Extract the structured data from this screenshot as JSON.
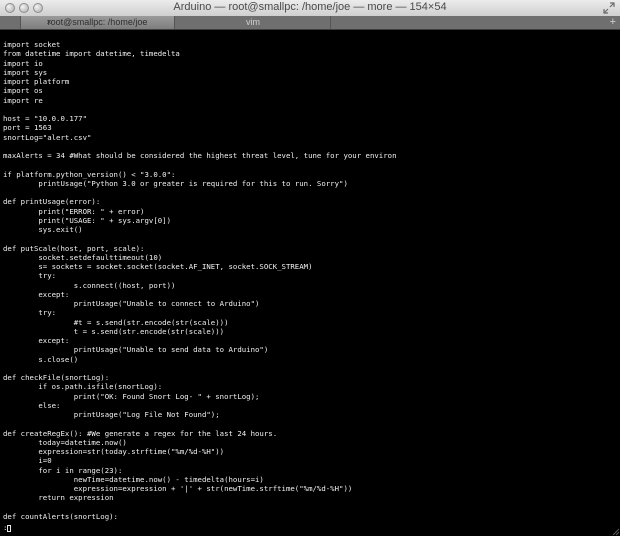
{
  "window": {
    "title": "Arduino — root@smallpc: /home/joe — more — 154×54"
  },
  "tabs": [
    {
      "label": "root@smallpc: /home/joe",
      "active": true
    },
    {
      "label": "vim",
      "active": false
    }
  ],
  "tab_bar": {
    "add_label": "+"
  },
  "terminal": {
    "lines": [
      "import socket",
      "from datetime import datetime, timedelta",
      "import io",
      "import sys",
      "import platform",
      "import os",
      "import re",
      "",
      "host = \"10.0.0.177\"",
      "port = 1563",
      "snortLog=\"alert.csv\"",
      "",
      "maxAlerts = 34 #What should be considered the highest threat level, tune for your environ",
      "",
      "if platform.python_version() < \"3.0.0\":",
      "        printUsage(\"Python 3.0 or greater is required for this to run. Sorry\")",
      "",
      "def printUsage(error):",
      "        print(\"ERROR: \" + error)",
      "        print(\"USAGE: \" + sys.argv[0])",
      "        sys.exit()",
      "",
      "def putScale(host, port, scale):",
      "        socket.setdefaulttimeout(10)",
      "        s= sockets = socket.socket(socket.AF_INET, socket.SOCK_STREAM)",
      "        try:",
      "                s.connect((host, port))",
      "        except:",
      "                printUsage(\"Unable to connect to Arduino\")",
      "        try:",
      "                #t = s.send(str.encode(str(scale)))",
      "                t = s.send(str.encode(str(scale)))",
      "        except:",
      "                printUsage(\"Unable to send data to Arduino\")",
      "        s.close()",
      "",
      "def checkFile(snortLog):",
      "        if os.path.isfile(snortLog):",
      "                print(\"OK: Found Snort Log- \" + snortLog);",
      "        else:",
      "                printUsage(\"Log File Not Found\");",
      "",
      "def createRegEx(): #We generate a regex for the last 24 hours.",
      "        today=datetime.now()",
      "        expression=str(today.strftime(\"%m/%d-%H\"))",
      "        i=0",
      "        for i in range(23):",
      "                newTime=datetime.now() - timedelta(hours=i)",
      "                expression=expression + '|' + str(newTime.strftime(\"%m/%d-%H\"))",
      "        return expression",
      "",
      "def countAlerts(snortLog):"
    ],
    "prompt": ":"
  }
}
